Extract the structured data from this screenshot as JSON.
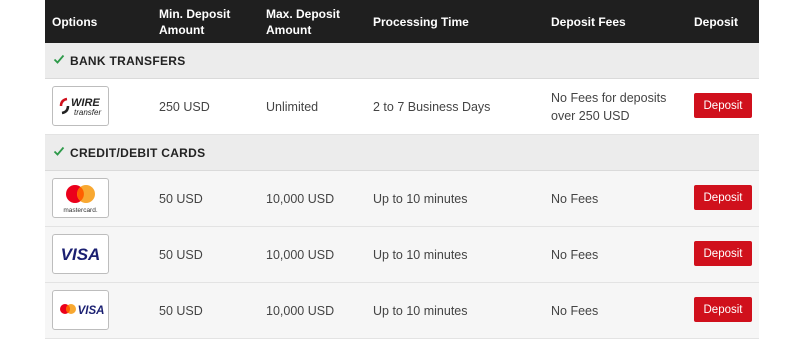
{
  "header": {
    "options": "Options",
    "min_deposit": "Min. Deposit Amount",
    "max_deposit": "Max. Deposit Amount",
    "processing": "Processing Time",
    "fees": "Deposit Fees",
    "deposit": "Deposit"
  },
  "sections": [
    {
      "title": "BANK TRANSFERS",
      "rows": [
        {
          "logo": "wire-transfer-logo",
          "logo_text": [
            "WIRE",
            "transfer"
          ],
          "min": "250 USD",
          "max": "Unlimited",
          "time": "2 to 7 Business Days",
          "fees": "No Fees for deposits over 250 USD",
          "button": "Deposit"
        }
      ]
    },
    {
      "title": "CREDIT/DEBIT CARDS",
      "rows": [
        {
          "logo": "mastercard-logo",
          "logo_text": [
            "mastercard."
          ],
          "min": "50 USD",
          "max": "10,000 USD",
          "time": "Up to 10 minutes",
          "fees": "No Fees",
          "button": "Deposit"
        },
        {
          "logo": "visa-logo",
          "logo_text": [
            "VISA"
          ],
          "min": "50 USD",
          "max": "10,000 USD",
          "time": "Up to 10 minutes",
          "fees": "No Fees",
          "button": "Deposit"
        },
        {
          "logo": "mastercard-visa-logo",
          "logo_text": [
            "VISA"
          ],
          "min": "50 USD",
          "max": "10,000 USD",
          "time": "Up to 10 minutes",
          "fees": "No Fees",
          "button": "Deposit"
        }
      ]
    }
  ],
  "colors": {
    "header_bg": "#1f1f1f",
    "button_red": "#d0101c",
    "check_green": "#2e9a4a",
    "visa_blue": "#1a1f71",
    "mastercard_red": "#eb001b",
    "mastercard_orange": "#f79e1b"
  }
}
